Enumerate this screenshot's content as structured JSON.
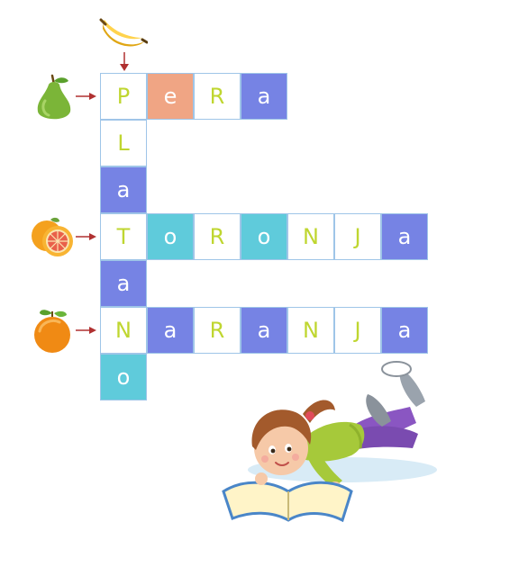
{
  "puzzle": {
    "words": [
      {
        "name": "pera",
        "direction": "across",
        "letters": [
          "P",
          "e",
          "R",
          "a"
        ],
        "clue_icon": "pear-icon"
      },
      {
        "name": "platano",
        "direction": "down",
        "letters": [
          "P",
          "L",
          "a",
          "T",
          "a",
          "N",
          "o"
        ],
        "clue_icon": "banana-icon"
      },
      {
        "name": "toronja",
        "direction": "across",
        "letters": [
          "T",
          "o",
          "R",
          "o",
          "N",
          "J",
          "a"
        ],
        "clue_icon": "grapefruit-icon"
      },
      {
        "name": "naranja",
        "direction": "across",
        "letters": [
          "N",
          "a",
          "R",
          "a",
          "N",
          "J",
          "a"
        ],
        "clue_icon": "orange-icon"
      }
    ]
  },
  "colors": {
    "letter_green": "#bfd630",
    "vowel_blue": "#7683e4",
    "vowel_cyan": "#5fcbdb",
    "vowel_salmon": "#f0a584",
    "cell_border": "#9fc5e8",
    "arrow_red": "#b03030"
  },
  "illustration": "girl-reading-book"
}
